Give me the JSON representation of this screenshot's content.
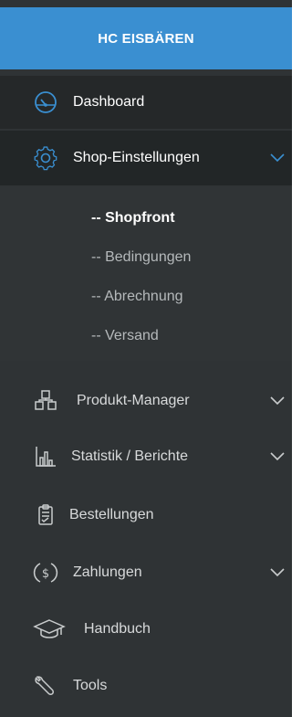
{
  "brand": {
    "title": "HC EISBÄREN"
  },
  "nav": {
    "dashboard": "Dashboard",
    "shop_settings": "Shop-Einstellungen",
    "sub": [
      "-- Shopfront",
      "-- Bedingungen",
      "-- Abrechnung",
      "-- Versand"
    ],
    "product_manager": "Produkt-Manager",
    "statistics": "Statistik / Berichte",
    "orders": "Bestellungen",
    "payments": "Zahlungen",
    "manual": "Handbuch",
    "tools": "Tools"
  },
  "colors": {
    "brand_bg": "#3a8fd1",
    "sidebar_bg": "#2f3335",
    "active_bg": "#222627",
    "icon_blue": "#3a8fd1"
  }
}
